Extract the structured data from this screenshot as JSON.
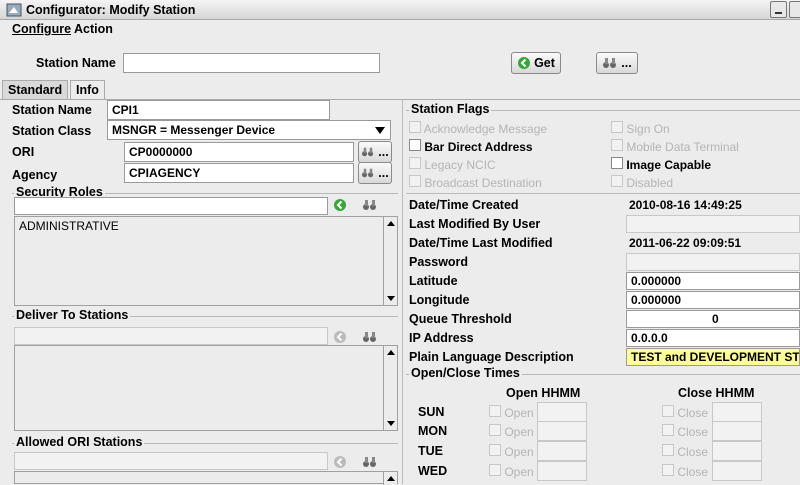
{
  "window": {
    "title": "Configurator: Modify Station"
  },
  "menu": {
    "configure": "Configure",
    "action": "Action"
  },
  "top": {
    "station_name_label": "Station Name",
    "station_name_value": "",
    "get_label": "Get",
    "lookup_label": "..."
  },
  "tabs": [
    {
      "label": "Standard"
    },
    {
      "label": "Info"
    }
  ],
  "left": {
    "station_name_label": "Station Name",
    "station_name_value": "CPI1",
    "station_class_label": "Station Class",
    "station_class_value": "MSNGR = Messenger Device",
    "ori_label": "ORI",
    "ori_value": "CP0000000",
    "agency_label": "Agency",
    "agency_value": "CPIAGENCY",
    "lookup_label": "...",
    "security_roles_label": "Security Roles",
    "security_roles_items": [
      "ADMINISTRATIVE"
    ],
    "deliver_label": "Deliver To Stations",
    "allowed_label": "Allowed ORI Stations"
  },
  "flags": {
    "title": "Station Flags",
    "acknowledge": "Acknowledge Message",
    "sign_on": "Sign On",
    "bar_direct": "Bar Direct Address",
    "mobile_terminal": "Mobile Data Terminal",
    "legacy_ncic": "Legacy NCIC",
    "image_capable": "Image Capable",
    "broadcast": "Broadcast Destination",
    "disabled": "Disabled"
  },
  "info": {
    "created_label": "Date/Time Created",
    "created_value": "2010-08-16 14:49:25",
    "modified_by_label": "Last Modified By User",
    "modified_by_value": "",
    "modified_label": "Date/Time Last Modified",
    "modified_value": "2011-06-22 09:09:51",
    "password_label": "Password",
    "password_value": "",
    "latitude_label": "Latitude",
    "latitude_value": "0.000000",
    "longitude_label": "Longitude",
    "longitude_value": "0.000000",
    "queue_label": "Queue Threshold",
    "queue_value": "0",
    "ip_label": "IP Address",
    "ip_value": "0.0.0.0",
    "plain_label": "Plain Language Description",
    "plain_value": "TEST and DEVELOPMENT STAT"
  },
  "times": {
    "title": "Open/Close Times",
    "open_header": "Open HHMM",
    "close_header": "Close HHMM",
    "open_label": "Open",
    "close_label": "Close",
    "days": [
      "SUN",
      "MON",
      "TUE",
      "WED"
    ]
  },
  "colors": {
    "highlight": "#ffff99",
    "go_green": "#3aa63a",
    "disabled_text": "#b4b4b4"
  }
}
